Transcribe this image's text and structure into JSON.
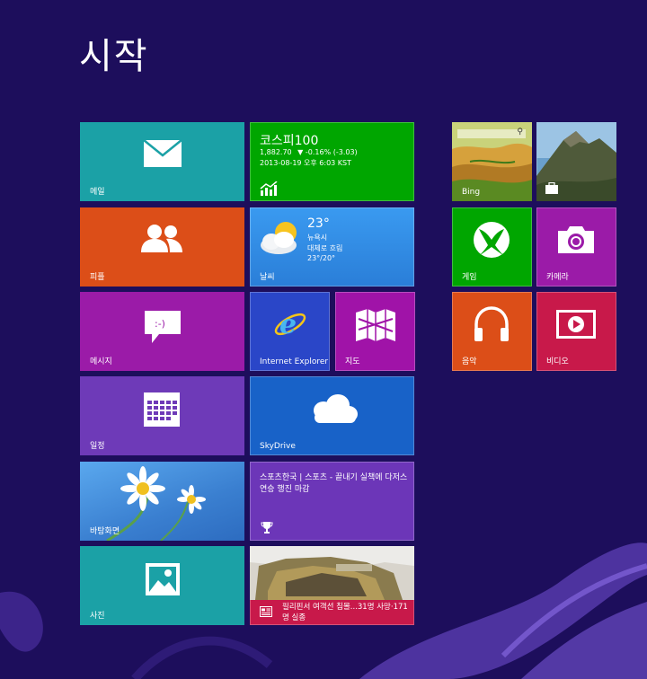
{
  "header": {
    "title": "시작"
  },
  "tiles": {
    "mail": {
      "label": "메일",
      "color": "#1ba1a6"
    },
    "stock": {
      "title": "코스피100",
      "line1_value": "1,882.70",
      "line1_arrow": "▼",
      "line1_change": "-0.16% (-3.03)",
      "line2": "2013-08-19 오후 6:03 KST",
      "color": "#00a600"
    },
    "people": {
      "label": "피플",
      "color": "#dc4e18"
    },
    "weather": {
      "label": "날씨",
      "temp": "23°",
      "city": "뉴욕시",
      "condition": "대체로 흐림",
      "range": "23°/20°",
      "color": "#2e8de0"
    },
    "messaging": {
      "label": "메시지",
      "color": "#9b1ba8"
    },
    "ie": {
      "label": "Internet Explorer",
      "color": "#2a46c8"
    },
    "maps": {
      "label": "지도",
      "color": "#a013a8"
    },
    "calendar": {
      "label": "일정",
      "color": "#6e3ab8"
    },
    "skydrive": {
      "label": "SkyDrive",
      "color": "#1862c8"
    },
    "sports": {
      "headline": "스포츠한국 | 스포츠 -  끝내기 실책에 다저스 연승 행진 마감",
      "color": "#6c36b8"
    },
    "desktop": {
      "label": "바탕화면",
      "color": "#4a90d8"
    },
    "photos": {
      "label": "사진",
      "color": "#1ba1a6"
    },
    "news": {
      "headline": "필리핀서 여객선 침몰...31명 사망·171명 실종",
      "color": "#c8194a"
    },
    "bing": {
      "label": "Bing"
    },
    "travel": {
      "label": ""
    },
    "games": {
      "label": "게임",
      "color": "#00a600"
    },
    "camera": {
      "label": "카메라",
      "color": "#9b1ba8"
    },
    "music": {
      "label": "음악",
      "color": "#dc4e18"
    },
    "video": {
      "label": "비디오",
      "color": "#c8194a"
    }
  }
}
